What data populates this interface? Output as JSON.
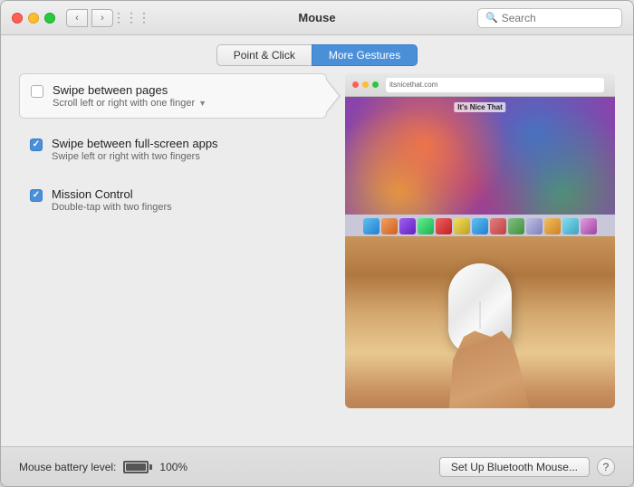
{
  "window": {
    "title": "Mouse",
    "traffic_lights": {
      "close_label": "",
      "minimize_label": "",
      "maximize_label": ""
    }
  },
  "search": {
    "placeholder": "Search"
  },
  "tabs": {
    "left": "Point & Click",
    "right": "More Gestures"
  },
  "options": [
    {
      "id": "swipe-pages",
      "title": "Swipe between pages",
      "subtitle": "Scroll left or right with one finger",
      "has_dropdown": true,
      "checked": false
    },
    {
      "id": "swipe-apps",
      "title": "Swipe between full-screen apps",
      "subtitle": "Swipe left or right with two fingers",
      "has_dropdown": false,
      "checked": true
    },
    {
      "id": "mission-control",
      "title": "Mission Control",
      "subtitle": "Double-tap with two fingers",
      "has_dropdown": false,
      "checked": true
    }
  ],
  "footer": {
    "battery_label": "Mouse battery level:",
    "battery_percent": "100%",
    "setup_button": "Set Up Bluetooth Mouse...",
    "help_button": "?"
  }
}
